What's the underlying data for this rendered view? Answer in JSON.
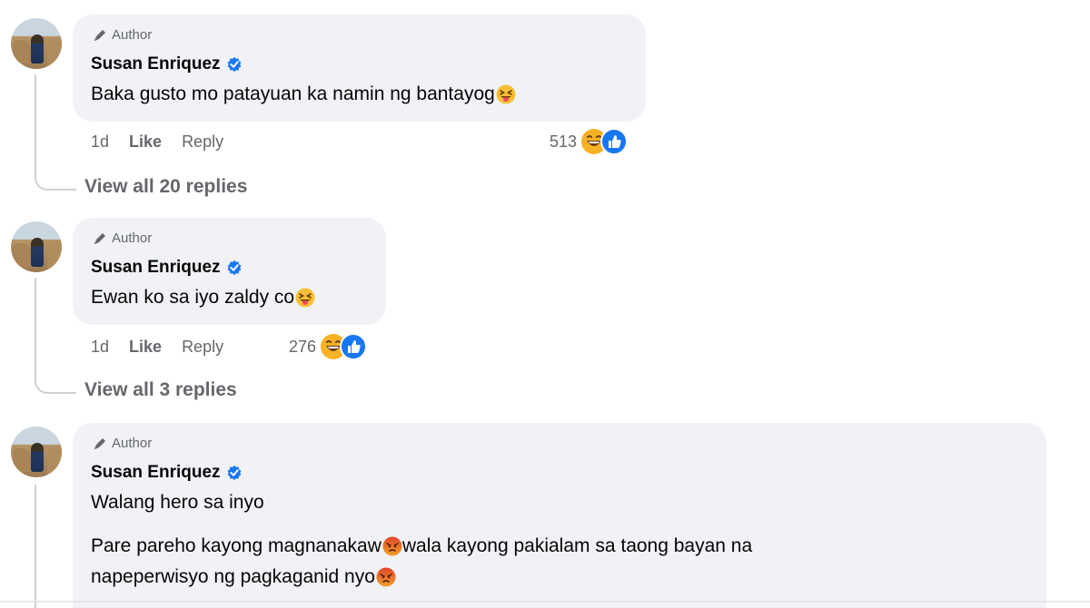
{
  "comments": [
    {
      "author_tag": "Author",
      "name": "Susan Enriquez",
      "text": "Baka gusto mo patayuan ka namin ng bantayog",
      "time": "1d",
      "like_label": "Like",
      "reply_label": "Reply",
      "reaction_count": "513",
      "view_replies": "View all 20 replies"
    },
    {
      "author_tag": "Author",
      "name": "Susan Enriquez",
      "text": "Ewan ko sa iyo zaldy co",
      "time": "1d",
      "like_label": "Like",
      "reply_label": "Reply",
      "reaction_count": "276",
      "view_replies": "View all 3 replies"
    },
    {
      "author_tag": "Author",
      "name": "Susan Enriquez",
      "paragraph1": "Walang hero sa inyo",
      "paragraph2_part1": "Pare pareho kayong magnanakaw",
      "paragraph2_part2": "wala kayong pakialam sa taong bayan na",
      "paragraph2_line2": "napeperwisyo ng pagkaganid nyo"
    }
  ],
  "icons": {
    "author": "pen-icon",
    "verified": "verified-badge-icon",
    "laugh": "squinting-tongue-emoji",
    "angry": "angry-face-emoji",
    "react_haha": "haha-reaction-icon",
    "react_like": "like-reaction-icon"
  },
  "colors": {
    "bubble": "#f0f2f5",
    "secondary_text": "#65676b",
    "verified_blue": "#1877f2",
    "like_blue": "#1877f2",
    "haha_yellow": "#f7b125",
    "angry_orange": "#e9710f"
  }
}
